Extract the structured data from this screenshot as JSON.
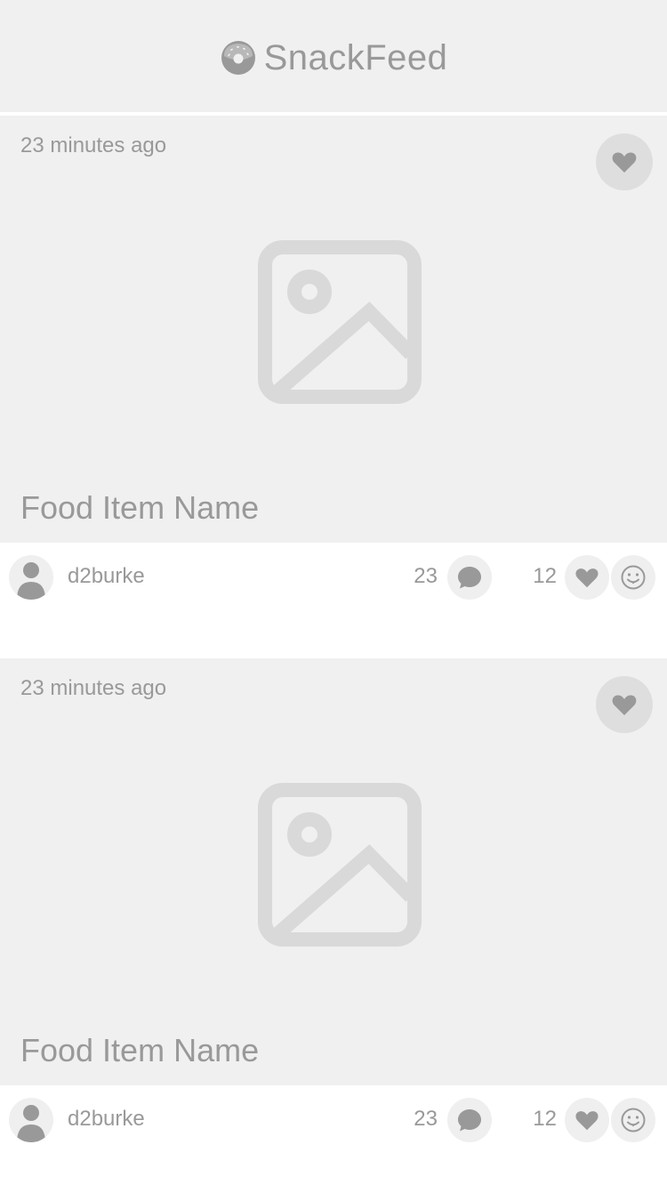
{
  "app": {
    "name": "SnackFeed",
    "logo_icon": "donut-icon"
  },
  "colors": {
    "header_bg": "#f0f0f0",
    "card_bg": "#f0f0f0",
    "icon_gray": "#999999",
    "placeholder_gray": "#d9d9d9"
  },
  "feed": {
    "posts": [
      {
        "time": "23 minutes ago",
        "title": "Food Item Name",
        "image_icon": "image-placeholder-icon",
        "favorite_icon": "heart-icon",
        "author": "d2burke",
        "avatar_icon": "user-avatar-icon",
        "comment_count": "23",
        "comment_icon": "speech-bubble-icon",
        "like_count": "12",
        "like_icon": "heart-icon",
        "react_icon": "smiley-icon"
      },
      {
        "time": "23 minutes ago",
        "title": "Food Item Name",
        "image_icon": "image-placeholder-icon",
        "favorite_icon": "heart-icon",
        "author": "d2burke",
        "avatar_icon": "user-avatar-icon",
        "comment_count": "23",
        "comment_icon": "speech-bubble-icon",
        "like_count": "12",
        "like_icon": "heart-icon",
        "react_icon": "smiley-icon"
      }
    ]
  }
}
